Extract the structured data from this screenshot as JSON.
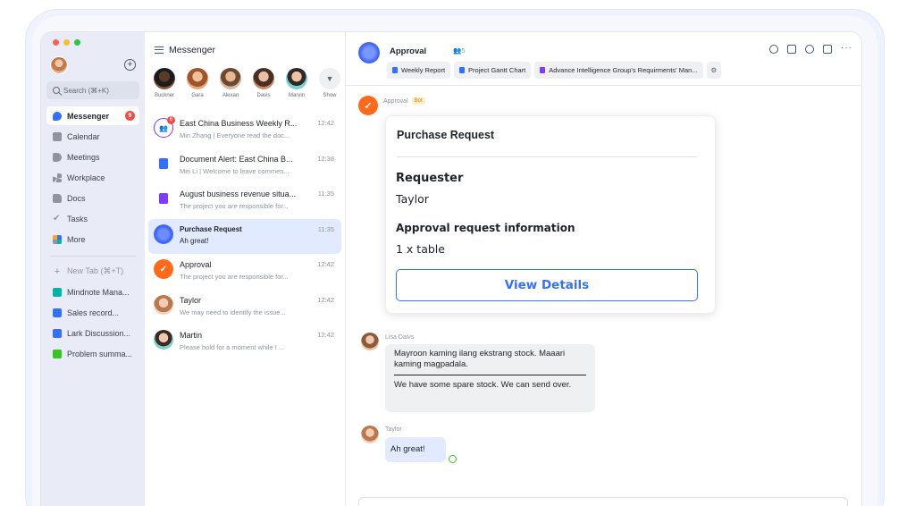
{
  "sidebar": {
    "search_placeholder": "Search (⌘+K)",
    "nav": [
      {
        "label": "Messenger",
        "icon": "messenger-icon",
        "badge": "9"
      },
      {
        "label": "Calendar",
        "icon": "calendar-icon"
      },
      {
        "label": "Meetings",
        "icon": "meetings-icon"
      },
      {
        "label": "Workplace",
        "icon": "workplace-icon"
      },
      {
        "label": "Docs",
        "icon": "docs-icon"
      },
      {
        "label": "Tasks",
        "icon": "tasks-icon"
      },
      {
        "label": "More",
        "icon": "more-icon"
      }
    ],
    "new_tab": "New Tab (⌘+T)",
    "pinned": [
      {
        "label": "Mindnote Mana...",
        "icon": "mindnote-icon"
      },
      {
        "label": "Sales record...",
        "icon": "doc-icon"
      },
      {
        "label": "Lark Discussion...",
        "icon": "doc-icon"
      },
      {
        "label": "Problem summa...",
        "icon": "sheet-icon"
      }
    ]
  },
  "chatlist": {
    "title": "Messenger",
    "stories": [
      {
        "name": "Buckner"
      },
      {
        "name": "Gara"
      },
      {
        "name": "Alexan"
      },
      {
        "name": "Davis"
      },
      {
        "name": "Marvin"
      },
      {
        "name": "Show"
      }
    ],
    "chats": [
      {
        "title": "East China Business Weekly R...",
        "subtitle": "Min Zhang | Everyone read the doc...",
        "time": "12:42",
        "badge": "6"
      },
      {
        "title": "Document Alert: East China B...",
        "subtitle": "Mei Li | Welcome to leave commen...",
        "time": "12:38"
      },
      {
        "title": "August business revenue situa...",
        "subtitle": "The project you are responsible for...",
        "time": "11:35"
      },
      {
        "title": "Purchase Request",
        "subtitle": "Ah great!",
        "time": "11:35"
      },
      {
        "title": "Approval",
        "subtitle": "The project you are responsible for...",
        "time": "12:42"
      },
      {
        "title": "Taylor",
        "subtitle": "We may need to identify the issue...",
        "time": "12:42"
      },
      {
        "title": "Martin",
        "subtitle": "Please hold for a moment while I ...",
        "time": "12:42"
      }
    ]
  },
  "main": {
    "title": "Approval",
    "members": "5",
    "tabs": [
      "Weekly Report",
      "Project Gantt Chart",
      "Advance Intelligence Group's Requirments' Man..."
    ],
    "bot_name": "Approval",
    "bot_tag": "Bot",
    "card": {
      "title": "Purchase Request",
      "label1": "Requester",
      "value1": "Taylor",
      "label2": "Approval request information",
      "value2": "1 x table",
      "button": "View Details"
    },
    "messages": [
      {
        "sender": "Lisa Daivs",
        "quote": "Mayroon kaming ilang ekstrang stock. Maaari kaming magpadala.",
        "text": "We have some spare stock. We can send over."
      },
      {
        "sender": "Taylor",
        "text": "Ah great!"
      }
    ]
  }
}
